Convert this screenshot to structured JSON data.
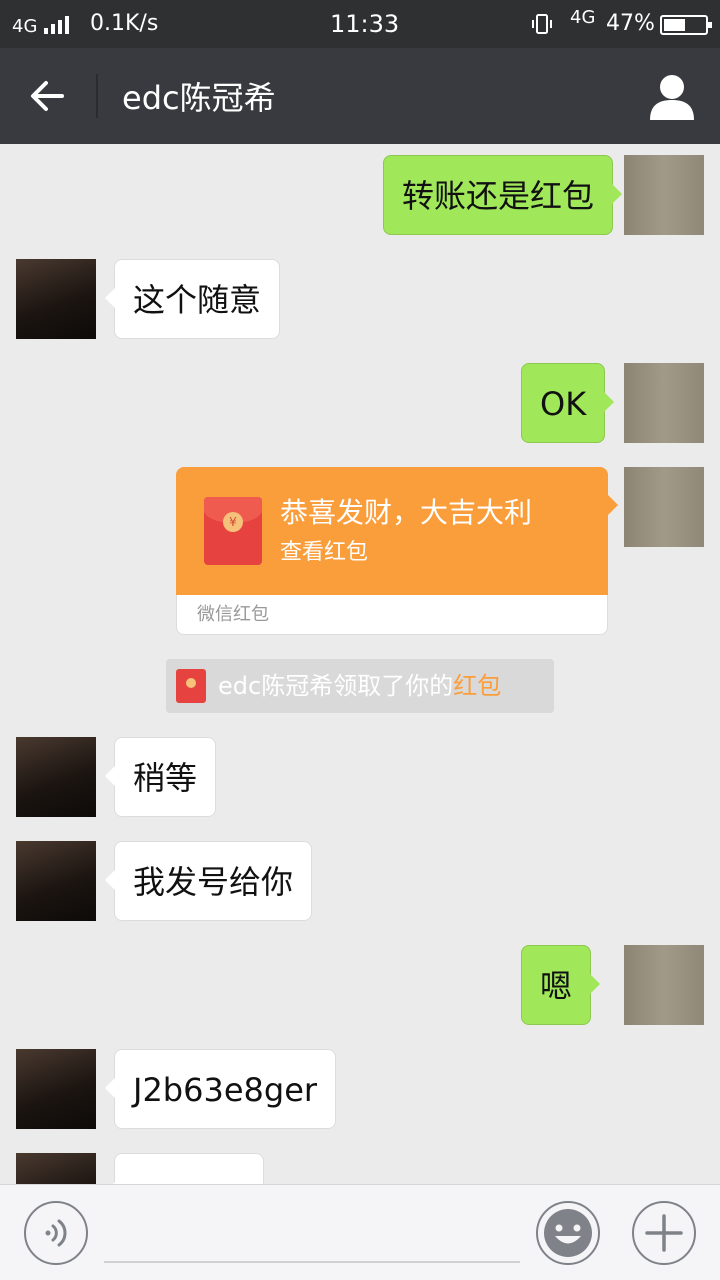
{
  "status_bar": {
    "network": "4G",
    "speed": "0.1K/s",
    "time": "11:33",
    "network2": "4G",
    "battery": "47%",
    "battery_level": 0.47
  },
  "header": {
    "title": "edc陈冠希",
    "back_icon": "arrow-left-icon",
    "profile_icon": "person-icon"
  },
  "messages": [
    {
      "from": "me",
      "text": "转账还是红包"
    },
    {
      "from": "them",
      "text": "这个随意"
    },
    {
      "from": "me",
      "text": "OK"
    },
    {
      "from": "me",
      "type": "red_packet",
      "title": "恭喜发财，大吉大利",
      "subtitle": "查看红包",
      "brand": "微信红包"
    },
    {
      "type": "system",
      "text": "edc陈冠希领取了你的",
      "link": "红包"
    },
    {
      "from": "them",
      "text": "稍等"
    },
    {
      "from": "them",
      "text": "我发号给你"
    },
    {
      "from": "me",
      "text": "嗯"
    },
    {
      "from": "them",
      "text": "J2b63e8ger"
    }
  ],
  "input_bar": {
    "voice_icon": "voice-icon",
    "input_value": "",
    "emoji_icon": "smiley-icon",
    "plus_icon": "plus-icon"
  },
  "colors": {
    "outgoing_bubble": "#a0e75a",
    "incoming_bubble": "#ffffff",
    "red_packet": "#fa9d3b",
    "nav_bar": "#393a3f",
    "status_bar": "#2e3032"
  }
}
